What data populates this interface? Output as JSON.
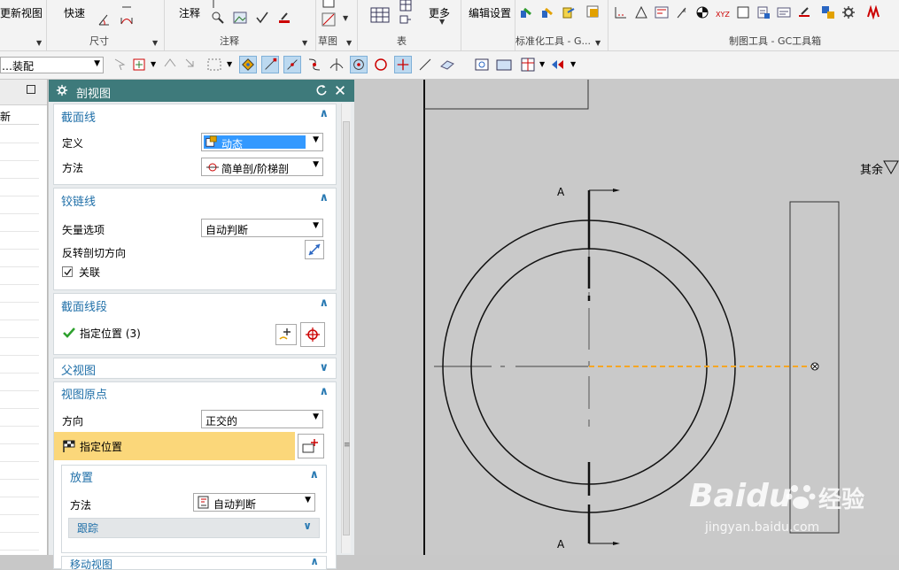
{
  "ribbon": {
    "update_view": "更新视图",
    "quick": "快速",
    "dimension_group": "尺寸",
    "annotation": "注释",
    "annotation_group": "注释",
    "sketch_group": "草图",
    "table_group": "表",
    "more": "更多",
    "drafting_prefs": "编辑设置",
    "std_tools_group": "标准化工具 - G...",
    "gc_tools_group": "制图工具 - GC工具箱"
  },
  "toolbar": {
    "filter_value": "…装配"
  },
  "navigator": {
    "header_text": "新"
  },
  "dialog": {
    "title": "剖视图",
    "section_line": {
      "title": "截面线",
      "define_label": "定义",
      "define_value": "动态",
      "method_label": "方法",
      "method_value": "简单剖/阶梯剖"
    },
    "hinge_line": {
      "title": "铰链线",
      "vector_label": "矢量选项",
      "vector_value": "自动判断",
      "reverse_label": "反转剖切方向",
      "associate_label": "关联"
    },
    "segments": {
      "title": "截面线段",
      "point_label": "指定位置 (3)"
    },
    "parent_view": {
      "title": "父视图"
    },
    "view_origin": {
      "title": "视图原点",
      "direction_label": "方向",
      "direction_value": "正交的",
      "location_label": "指定位置",
      "placement": {
        "title": "放置",
        "method_label": "方法",
        "method_value": "自动判断",
        "track_label": "跟踪"
      },
      "move_view_title": "移动视图"
    }
  },
  "drawing": {
    "section_letter_top": "A",
    "section_letter_bottom": "A",
    "roughness_text": "其余"
  },
  "watermark": {
    "brand": "Baidu",
    "cn": "经验",
    "url": "jingyan.baidu.com"
  },
  "colors": {
    "dialog_title_bg": "#3e7a7b",
    "section_heading": "#1f6fa8",
    "highlight_row": "#fbd77a",
    "selected_combo": "#3399ff",
    "preview_line": "#f5a623"
  }
}
